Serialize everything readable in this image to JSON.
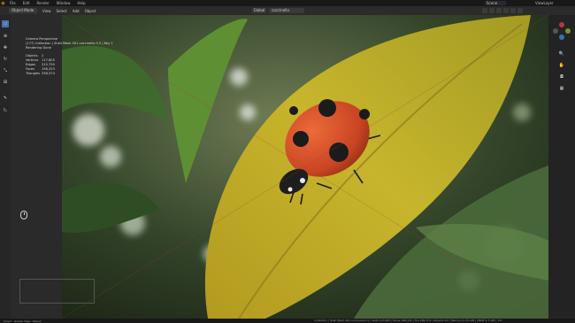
{
  "menubar": {
    "items": [
      "File",
      "Edit",
      "Render",
      "Window",
      "Help"
    ],
    "workspace": "Layout",
    "scene": "Scene",
    "view_layer": "ViewLayer"
  },
  "header": {
    "mode": "Object Mode",
    "menus": [
      "View",
      "Select",
      "Add",
      "Object"
    ],
    "global_label": "Global",
    "image_name": "coccinella"
  },
  "stats": {
    "title": "Camera Perspective",
    "collection": "(177) Collection | Shell Mesh 001.coccinella 0.5 | Key 1",
    "render_state": "Rendering Done",
    "rows": [
      {
        "k": "Objects",
        "v": "2"
      },
      {
        "k": "Vertices",
        "v": "117,805"
      },
      {
        "k": "Edges",
        "v": "315,750"
      },
      {
        "k": "Faces",
        "v": "198,333"
      },
      {
        "k": "Triangles",
        "v": "298,374"
      }
    ]
  },
  "statusbar": {
    "left": "Select  ·  Rotate View  ·  Object",
    "right": "Collection | Shell Mesh 001.coccinella 0.5 | Verts 117,805 | Faces 198,333 | Tris 298,374 | Objects 0/2 | Memory 9.70 GiB | VRAM 4.7 GiB | 3.6"
  },
  "colors": {
    "accent": "#4772b3",
    "brand": "#e87d0d"
  }
}
